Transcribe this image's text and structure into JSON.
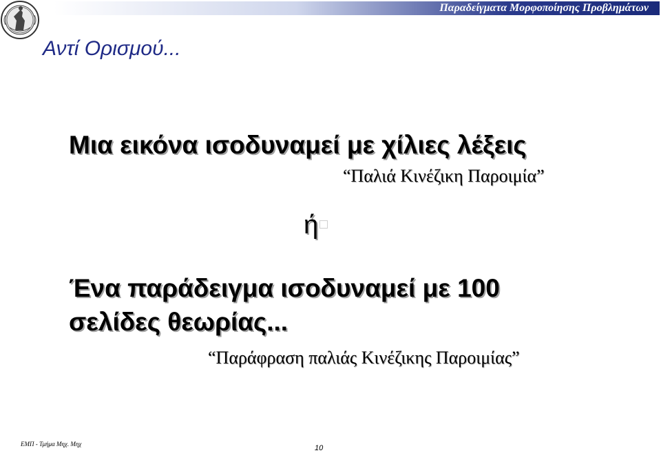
{
  "header": {
    "title": "Παραδείγματα  Μορφοποίησης Προβλημάτων",
    "bar_color": "#1a2a7a"
  },
  "logo": {
    "icon": "university-seal-icon"
  },
  "slide": {
    "subtitle": "Αντί Ορισμού...",
    "line1": "Μια εικόνα ισοδυναμεί με χίλιες λέξεις",
    "quote1": "“Παλιά Κινέζικη Παροιμία”",
    "or_word": "ή",
    "line2a": "Ένα παράδειγμα ισοδυναμεί με 100",
    "line2b": "σελίδες θεωρίας...",
    "quote2": "“Παράφραση παλιάς Κινέζικης Παροιμίας”"
  },
  "footer": {
    "dept": "ΕΜΠ - Τμήμα Μηχ. Μηχ",
    "page_number": "10"
  },
  "colors": {
    "subtitle": "#1f2a86",
    "text": "#000000"
  }
}
